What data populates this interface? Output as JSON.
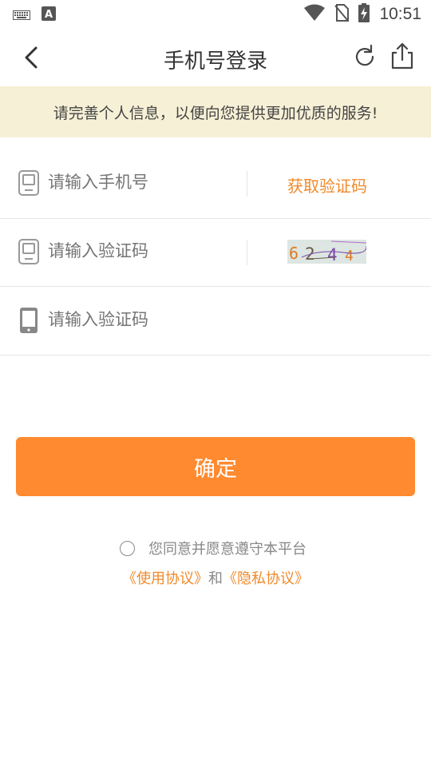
{
  "status_bar": {
    "time": "10:51",
    "icons": [
      "keyboard-icon",
      "text-a-icon",
      "wifi-icon",
      "no-sim-icon",
      "battery-charging-icon"
    ]
  },
  "nav": {
    "title": "手机号登录",
    "icons": [
      "back-arrow-icon",
      "refresh-icon",
      "share-icon"
    ]
  },
  "notice": {
    "text": "请完善个人信息，以便向您提供更加优质的服务!"
  },
  "form": {
    "phone": {
      "placeholder": "请输入手机号",
      "action_label": "获取验证码",
      "icon": "phone-outline-icon"
    },
    "image_code": {
      "placeholder": "请输入验证码",
      "icon": "phone-outline-icon",
      "captcha_text": "6 2 4 4"
    },
    "sms_code": {
      "placeholder": "请输入验证码",
      "icon": "phone-filled-icon"
    }
  },
  "confirm": {
    "label": "确定"
  },
  "agreement": {
    "text": "您同意并愿意遵守本平台",
    "user_agreement": "《使用协议》",
    "and": "和",
    "privacy_agreement": "《隐私协议》"
  },
  "colors": {
    "accent": "#ff8a30",
    "link": "#f08a2c",
    "notice_bg": "#f6f0d6",
    "placeholder": "#c0c0c0"
  }
}
